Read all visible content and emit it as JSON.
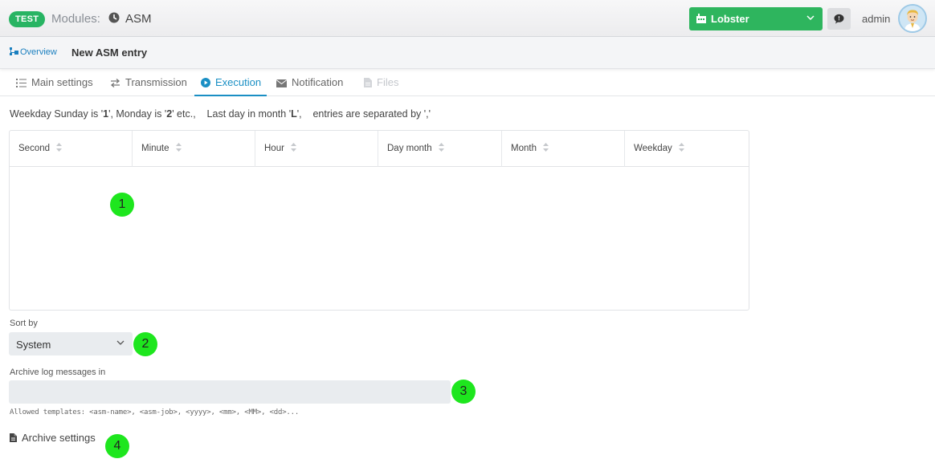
{
  "header": {
    "env_badge": "TEST",
    "modules_label": "Modules:",
    "module_name": "ASM",
    "company": "Lobster",
    "user": "admin"
  },
  "breadcrumb": {
    "overview": "Overview",
    "title": "New ASM entry"
  },
  "tabs": [
    {
      "label": "Main settings",
      "icon": "list-icon",
      "state": "normal"
    },
    {
      "label": "Transmission",
      "icon": "arrows-icon",
      "state": "normal"
    },
    {
      "label": "Execution",
      "icon": "play-circle-icon",
      "state": "active"
    },
    {
      "label": "Notification",
      "icon": "envelope-icon",
      "state": "normal"
    },
    {
      "label": "Files",
      "icon": "file-icon",
      "state": "disabled"
    }
  ],
  "hint": {
    "p1": "Weekday Sunday is '",
    "b1": "1",
    "p2": "', Monday is '",
    "b2": "2",
    "p3": "' etc.,    Last day in month '",
    "b3": "L",
    "p4": "',    entries are separated by ','"
  },
  "schedule_table": {
    "columns": [
      "Second",
      "Minute",
      "Hour",
      "Day month",
      "Month",
      "Weekday"
    ],
    "rows": []
  },
  "sort": {
    "label": "Sort by",
    "value": "System"
  },
  "archive": {
    "label": "Archive log messages in",
    "value": "",
    "allowed_templates": "Allowed templates: <asm-name>, <asm-job>, <yyyy>, <mm>, <MM>, <dd>..."
  },
  "archive_settings": "Archive settings",
  "markers": [
    "1",
    "2",
    "3",
    "4"
  ],
  "colors": {
    "accent": "#1a8fc4",
    "brand_green": "#2eb55e",
    "marker": "#1ee61e"
  }
}
